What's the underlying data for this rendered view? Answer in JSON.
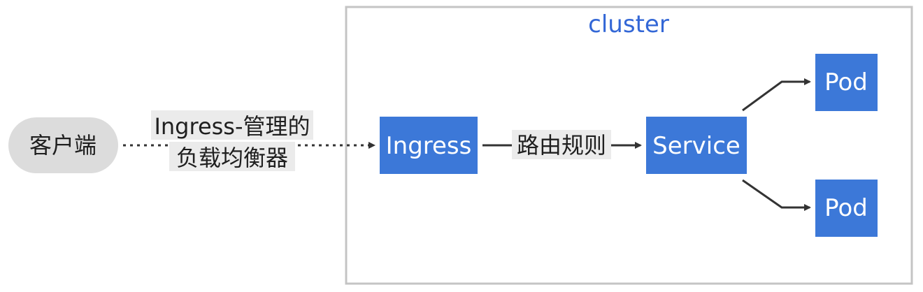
{
  "cluster": {
    "label": "cluster"
  },
  "nodes": {
    "client": "客户端",
    "ingress": "Ingress",
    "service": "Service",
    "pod_top": "Pod",
    "pod_bottom": "Pod"
  },
  "edges": {
    "client_to_ingress": {
      "line1": "Ingress-管理的",
      "line2": "负载均衡器"
    },
    "ingress_to_service": "路由规则"
  },
  "colors": {
    "node_fill": "#3c78d8",
    "client_fill": "#dcdcdc",
    "cluster_border": "#c4c4c4",
    "cluster_label": "#3367d6",
    "edge_label_bg": "#ebebeb",
    "arrow": "#333333"
  }
}
